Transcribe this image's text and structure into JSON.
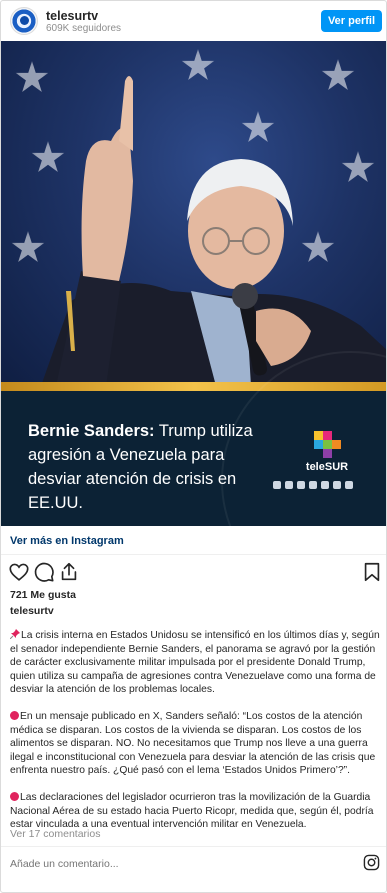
{
  "header": {
    "username": "telesurtv",
    "followers": "609K seguidores",
    "view_profile_label": "Ver perfil"
  },
  "post": {
    "headline_name": "Bernie Sanders:",
    "headline_rest": " Trump utiliza agresión a Venezuela para desviar atención de crisis en EE.UU.",
    "brand": "teleSUR",
    "photo_alt": "Bernie Sanders hablando con micrófono"
  },
  "links": {
    "view_more": "Ver más en Instagram"
  },
  "actions": {
    "like_icon": "heart-icon",
    "comment_icon": "comment-icon",
    "share_icon": "share-icon",
    "save_icon": "bookmark-icon"
  },
  "likes": "721 Me gusta",
  "caption": {
    "username": "telesurtv",
    "p1": "La crisis interna en Estados Unidosu se intensificó en los últimos días y, según el senador independiente Bernie Sanders, el panorama se agravó por la gestión de carácter exclusivamente militar impulsada por el presidente Donald Trump, quien utiliza su campaña de agresiones contra Venezuelave como una forma de desviar la atención de los problemas locales.",
    "p2": "En un mensaje publicado en X, Sanders señaló: “Los costos de la atención médica se disparan. Los costos de la vivienda se disparan. Los costos de los alimentos se disparan. NO. No necesitamos que Trump nos lleve a una guerra ilegal e inconstitucional con Venezuela para desviar la atención de las crisis que enfrenta nuestro país. ¿Qué pasó con el lema ‘Estados Unidos Primero’?”.",
    "p3": "Las declaraciones del legislador ocurrieron tras la movilización de la Guardia Nacional Aérea de su estado hacia Puerto Ricopr, medida que, según él, podría estar vinculada a una eventual intervención militar en Venezuela."
  },
  "comments_link": "Ver 17 comentarios",
  "add_comment_placeholder": "Añade un comentario...",
  "colors": {
    "accent": "#0095f6",
    "link": "#00376b",
    "card_bg": "#0c2235",
    "gold": "#f3c24a"
  }
}
